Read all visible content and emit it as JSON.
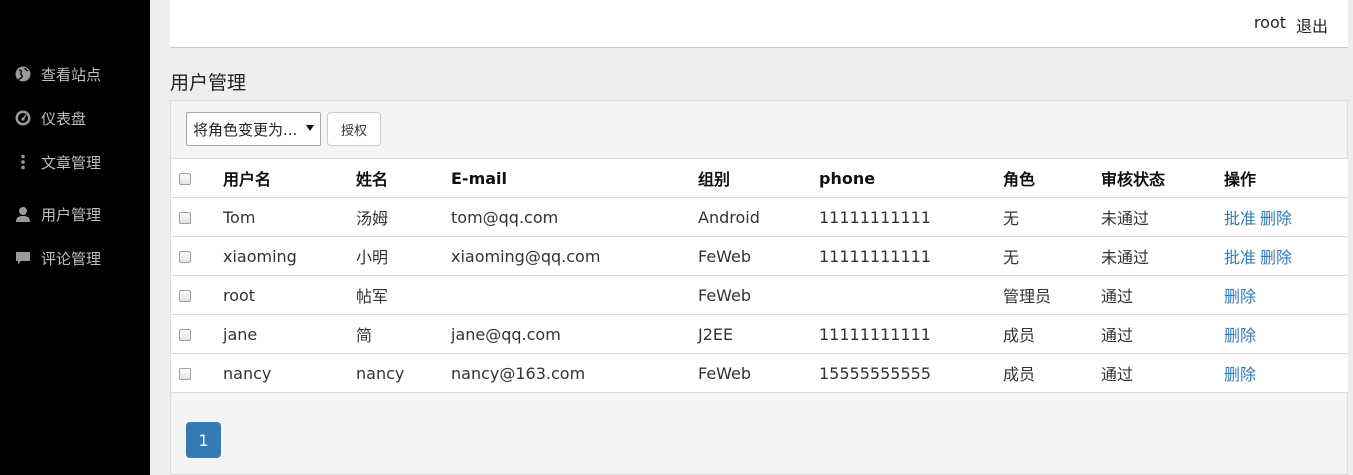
{
  "sidebar": {
    "items": [
      {
        "label": "查看站点",
        "icon": "globe-icon"
      },
      {
        "label": "仪表盘",
        "icon": "dashboard-icon"
      },
      {
        "label": "文章管理",
        "icon": "more-vertical-icon"
      },
      {
        "label": "用户管理",
        "icon": "user-icon"
      },
      {
        "label": "评论管理",
        "icon": "comment-icon"
      }
    ]
  },
  "topbar": {
    "username": "root",
    "logout": "退出"
  },
  "page": {
    "title": "用户管理"
  },
  "toolbar": {
    "role_select": "将角色变更为...",
    "grant_button": "授权"
  },
  "table": {
    "headers": [
      "用户名",
      "姓名",
      "E-mail",
      "组别",
      "phone",
      "角色",
      "审核状态",
      "操作"
    ],
    "rows": [
      {
        "username": "Tom",
        "name": "汤姆",
        "email": "tom@qq.com",
        "group": "Android",
        "phone": "11111111111",
        "role": "无",
        "status": "未通过",
        "approve": "批准",
        "delete": "删除"
      },
      {
        "username": "xiaoming",
        "name": "小明",
        "email": "xiaoming@qq.com",
        "group": "FeWeb",
        "phone": "11111111111",
        "role": "无",
        "status": "未通过",
        "approve": "批准",
        "delete": "删除"
      },
      {
        "username": "root",
        "name": "帖军",
        "email": "",
        "group": "FeWeb",
        "phone": "",
        "role": "管理员",
        "status": "通过",
        "approve": "",
        "delete": "删除"
      },
      {
        "username": "jane",
        "name": "简",
        "email": "jane@qq.com",
        "group": "J2EE",
        "phone": "11111111111",
        "role": "成员",
        "status": "通过",
        "approve": "",
        "delete": "删除"
      },
      {
        "username": "nancy",
        "name": "nancy",
        "email": "nancy@163.com",
        "group": "FeWeb",
        "phone": "15555555555",
        "role": "成员",
        "status": "通过",
        "approve": "",
        "delete": "删除"
      }
    ]
  },
  "pagination": {
    "current": "1"
  },
  "colors": {
    "sidebar_bg": "#000000",
    "link": "#337ab7",
    "pager_active": "#337ab7"
  }
}
